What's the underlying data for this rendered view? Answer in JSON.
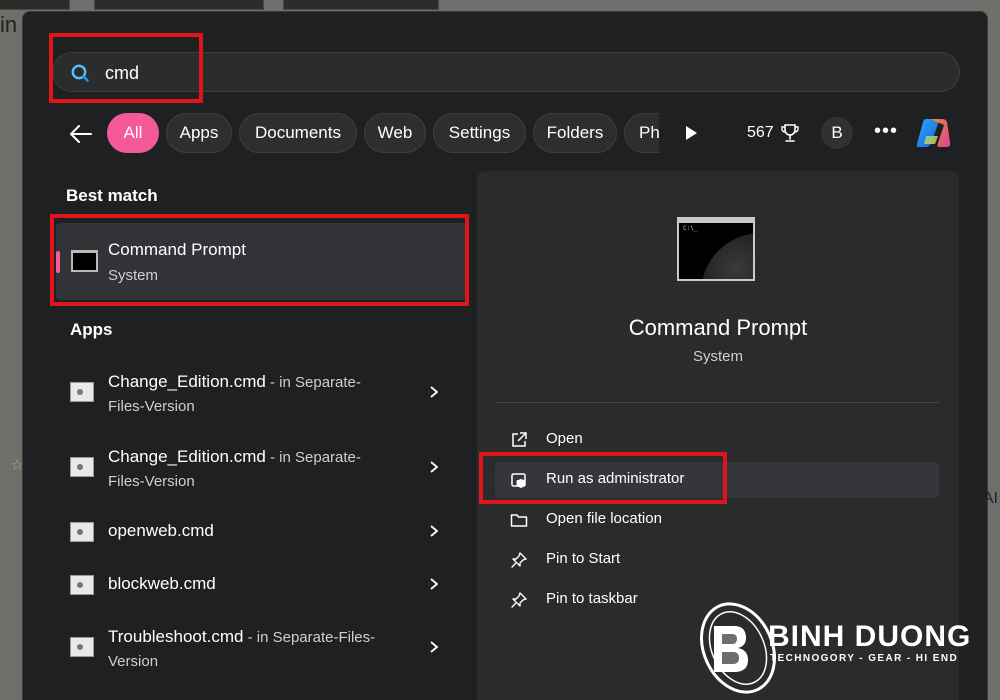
{
  "search": {
    "value": "cmd",
    "placeholder": ""
  },
  "filters": {
    "chips": [
      "All",
      "Apps",
      "Documents",
      "Web",
      "Settings",
      "Folders",
      "Ph"
    ],
    "active_index": 0
  },
  "header": {
    "points": "567",
    "avatar_initial": "B"
  },
  "icons": {
    "search": "search-icon",
    "back": "back-arrow-icon",
    "play": "play-icon",
    "trophy": "trophy-icon",
    "more": "more-icon",
    "copilot": "copilot-icon",
    "chevron": "chevron-right-icon"
  },
  "colors": {
    "accent": "#f45a9a",
    "highlight": "#e0141b",
    "panel": "#1f2022"
  },
  "best_match": {
    "heading": "Best match",
    "title": "Command Prompt",
    "subtitle": "System"
  },
  "apps": {
    "heading": "Apps",
    "items": [
      {
        "name": "Change_Edition.cmd",
        "location": " - in Separate-",
        "location2": "Files-Version"
      },
      {
        "name": "Change_Edition.cmd",
        "location": " - in Separate-",
        "location2": "Files-Version"
      },
      {
        "name": "openweb.cmd",
        "location": "",
        "location2": ""
      },
      {
        "name": "blockweb.cmd",
        "location": "",
        "location2": ""
      },
      {
        "name": "Troubleshoot.cmd",
        "location": " - in Separate-Files-",
        "location2": "Version"
      }
    ]
  },
  "details": {
    "title": "Command Prompt",
    "subtitle": "System",
    "actions": [
      {
        "label": "Open",
        "icon": "open-external-icon"
      },
      {
        "label": "Run as administrator",
        "icon": "shield-icon"
      },
      {
        "label": "Open file location",
        "icon": "folder-icon"
      },
      {
        "label": "Pin to Start",
        "icon": "pin-icon"
      },
      {
        "label": "Pin to taskbar",
        "icon": "pin-icon"
      }
    ]
  },
  "watermark": {
    "name": "BINH DUONG",
    "tagline": "TECHNOGORY - GEAR - HI END"
  }
}
